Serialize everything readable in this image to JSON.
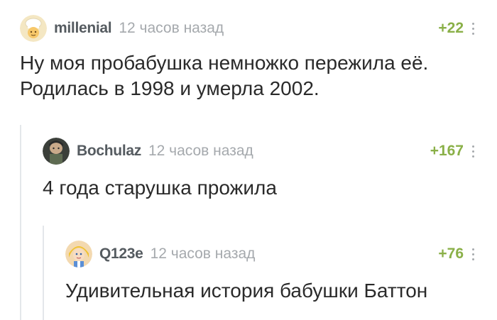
{
  "comments": [
    {
      "author": "millenial",
      "time": "12 часов назад",
      "rating": "+22",
      "lines": [
        "Ну моя пробабушка немножко пережила её.",
        "Родилась в 1998 и умерла 2002."
      ],
      "avatar_icon": "chef-avatar-icon"
    },
    {
      "author": "Bochulaz",
      "time": "12 часов назад",
      "rating": "+167",
      "lines": [
        "4 года старушка прожила"
      ],
      "avatar_icon": "portrait-avatar-icon"
    },
    {
      "author": "Q123e",
      "time": "12 часов назад",
      "rating": "+76",
      "lines": [
        "Удивительная история бабушки Баттон"
      ],
      "avatar_icon": "cartoon-avatar-icon"
    }
  ],
  "colors": {
    "author": "#555b60",
    "time": "#a5a9ad",
    "rating": "#8ab048",
    "branch_line": "#e4e7ea"
  }
}
